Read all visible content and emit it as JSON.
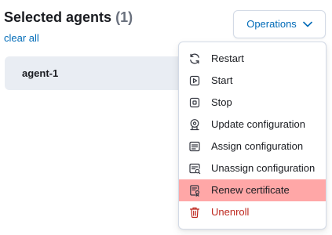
{
  "header": {
    "title": "Selected agents",
    "count": "(1)",
    "clear_all": "clear all"
  },
  "agents": [
    {
      "name": "agent-1"
    }
  ],
  "operations": {
    "label": "Operations",
    "icon": "chevron-down-icon",
    "items": [
      {
        "label": "Restart",
        "icon": "refresh-icon"
      },
      {
        "label": "Start",
        "icon": "play-icon"
      },
      {
        "label": "Stop",
        "icon": "stop-icon"
      },
      {
        "label": "Update configuration",
        "icon": "update-configuration-icon"
      },
      {
        "label": "Assign configuration",
        "icon": "assign-configuration-icon"
      },
      {
        "label": "Unassign configuration",
        "icon": "unassign-configuration-icon"
      },
      {
        "label": "Renew certificate",
        "icon": "certificate-icon",
        "highlighted": true
      },
      {
        "label": "Unenroll",
        "icon": "trash-icon",
        "danger": true
      }
    ]
  },
  "colors": {
    "link": "#006bb8",
    "danger": "#bd271e",
    "highlight": "#ffa7a7",
    "card_bg": "#e9edf3",
    "text": "#1a1c21",
    "muted": "#69707d"
  }
}
